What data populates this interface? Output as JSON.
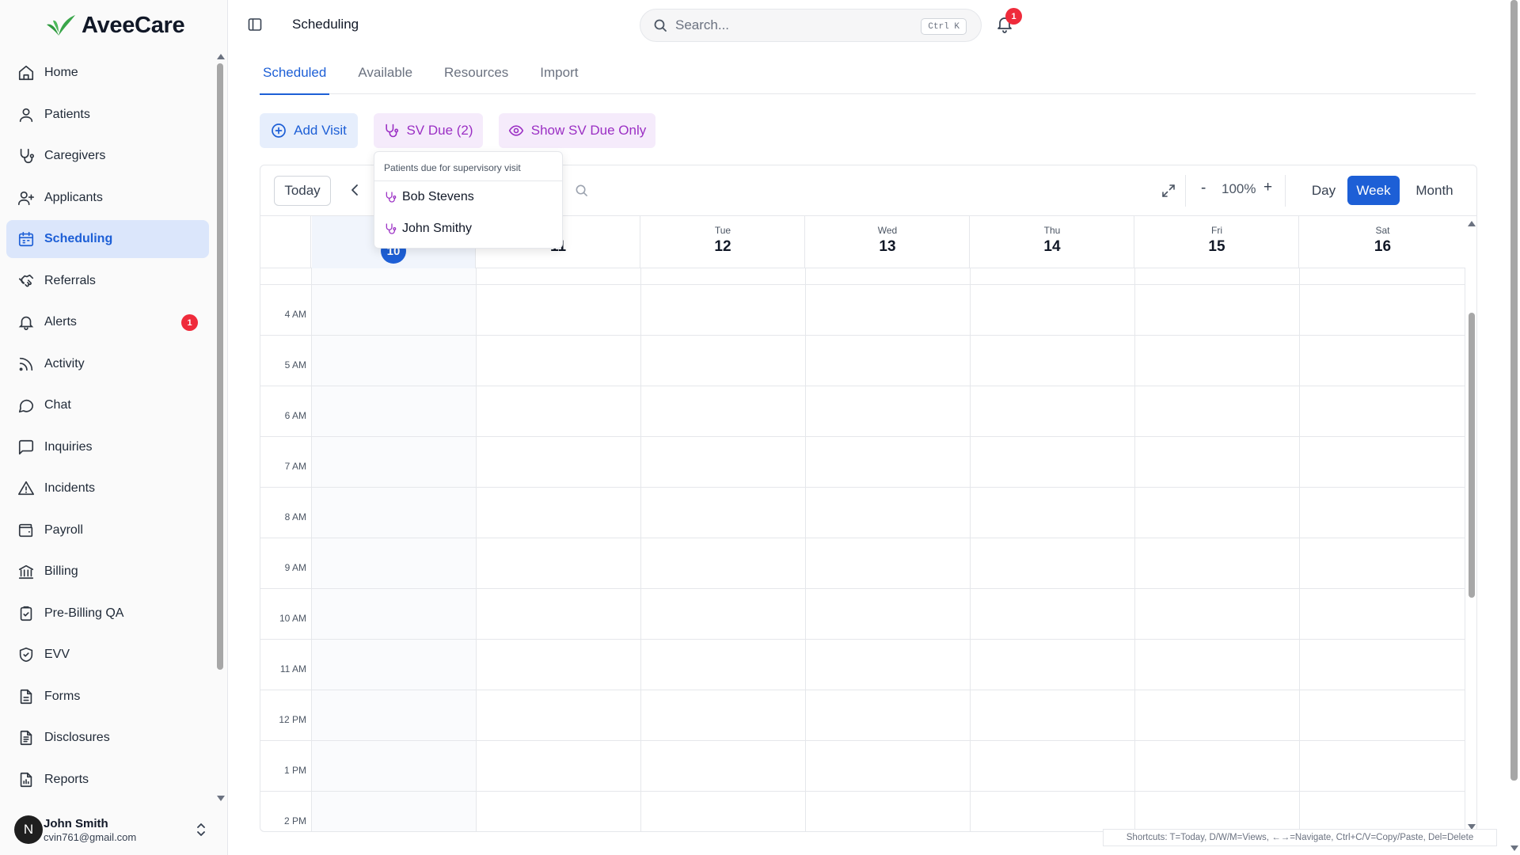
{
  "app": {
    "name": "AveeCare"
  },
  "colors": {
    "accent": "#1d5fd6",
    "sv_purple": "#9b2fc4",
    "badge_red": "#ef2b3b"
  },
  "sidebar": {
    "items": [
      {
        "label": "Home",
        "icon": "home-icon"
      },
      {
        "label": "Patients",
        "icon": "user-icon"
      },
      {
        "label": "Caregivers",
        "icon": "stethoscope-icon"
      },
      {
        "label": "Applicants",
        "icon": "user-plus-icon"
      },
      {
        "label": "Scheduling",
        "icon": "calendar-icon",
        "active": true
      },
      {
        "label": "Referrals",
        "icon": "handshake-icon"
      },
      {
        "label": "Alerts",
        "icon": "bell-icon",
        "badge": "1"
      },
      {
        "label": "Activity",
        "icon": "rss-icon"
      },
      {
        "label": "Chat",
        "icon": "message-circle-icon"
      },
      {
        "label": "Inquiries",
        "icon": "message-square-icon"
      },
      {
        "label": "Incidents",
        "icon": "alert-triangle-icon"
      },
      {
        "label": "Payroll",
        "icon": "wallet-icon"
      },
      {
        "label": "Billing",
        "icon": "bank-icon"
      },
      {
        "label": "Pre-Billing QA",
        "icon": "clipboard-check-icon"
      },
      {
        "label": "EVV",
        "icon": "shield-check-icon"
      },
      {
        "label": "Forms",
        "icon": "file-text-icon"
      },
      {
        "label": "Disclosures",
        "icon": "file-lines-icon"
      },
      {
        "label": "Reports",
        "icon": "file-chart-icon"
      }
    ]
  },
  "user": {
    "initial": "N",
    "name": "John Smith",
    "email": "cvin761@gmail.com"
  },
  "header": {
    "title": "Scheduling",
    "search_placeholder": "Search...",
    "search_shortcut": "Ctrl K",
    "notification_count": "1"
  },
  "tabs": [
    {
      "label": "Scheduled",
      "active": true
    },
    {
      "label": "Available"
    },
    {
      "label": "Resources"
    },
    {
      "label": "Import"
    }
  ],
  "actions": {
    "add_visit": "Add Visit",
    "sv_due": "SV Due (2)",
    "show_sv_due_only": "Show SV Due Only"
  },
  "sv_dropdown": {
    "title": "Patients due for supervisory visit",
    "patients": [
      "Bob Stevens",
      "John Smithy"
    ]
  },
  "calendar": {
    "today_label": "Today",
    "zoom": "100%",
    "zoom_minus": "-",
    "zoom_plus": "+",
    "views": [
      "Day",
      "Week",
      "Month"
    ],
    "active_view": "Week",
    "days": [
      {
        "dow": "",
        "num": "10",
        "today": true
      },
      {
        "dow": "n",
        "num": "11"
      },
      {
        "dow": "Tue",
        "num": "12"
      },
      {
        "dow": "Wed",
        "num": "13"
      },
      {
        "dow": "Thu",
        "num": "14"
      },
      {
        "dow": "Fri",
        "num": "15"
      },
      {
        "dow": "Sat",
        "num": "16"
      }
    ],
    "hours": [
      "4 AM",
      "5 AM",
      "6 AM",
      "7 AM",
      "8 AM",
      "9 AM",
      "10 AM",
      "11 AM",
      "12 PM",
      "1 PM",
      "2 PM"
    ]
  },
  "shortcuts_text": "Shortcuts: T=Today, D/W/M=Views, ←→=Navigate, Ctrl+C/V=Copy/Paste, Del=Delete"
}
